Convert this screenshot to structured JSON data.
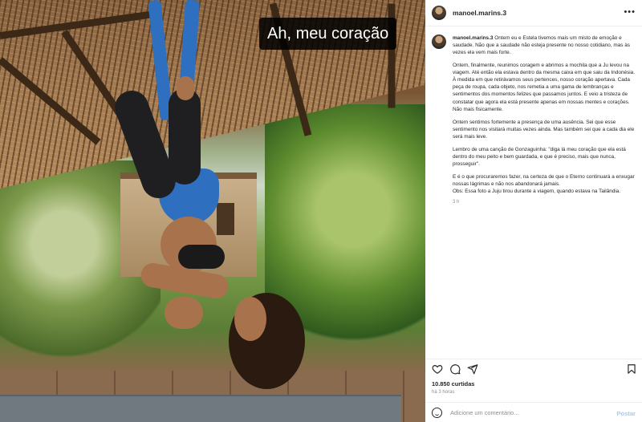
{
  "photo": {
    "sticker_text": "Ah, meu coração"
  },
  "header": {
    "username": "manoel.marins.3",
    "more_icon": "more-horizontal-icon"
  },
  "caption": {
    "username": "manoel.marins.3",
    "paragraphs": [
      "Ontem eu e Estela tivemos mais um misto de emoção e saudade. Não que a saudade não esteja presente no nosso cotidiano, mas às vezes ela vem mais forte.",
      "Ontem, finalmente, reunimos coragem e abrimos a mochila que a Ju levou na viagem. Até então ela estava dentro da mesma caixa em que saiu da Indonésia. À medida em que retirávamos seus pertences, nosso coração apertava. Cada peça de roupa, cada objeto, nos remetia a uma gama de lembranças e sentimentos dos momentos felizes que passamos juntos. E veio a tristeza de constatar que agora ela está presente apenas em nossas mentes e corações. Não mais fisicamente.",
      "Ontem sentimos fortemente a presença de uma ausência. Sei que esse sentimento nos visitará muitas vezes ainda. Mas também sei que a cada dia ele será mais leve.",
      "Lembro de uma canção de Gonzaguinha: \"diga lá meu coração que ela está dentro do meu peito e bem guardada, e que é preciso, mais que nunca, prosseguir\".",
      "E é o que procuraremos fazer, na certeza de que o Eterno continuará a enxugar nossas lágrimas e não nos abandonará jamais.\nObs: Essa foto a Juju tirou durante a viagem, quando estava na Tailândia."
    ],
    "time": "3 h"
  },
  "actions": {
    "icons": [
      "heart-icon",
      "comment-icon",
      "share-icon",
      "bookmark-icon"
    ]
  },
  "likes": "10.850 curtidas",
  "posted_ago": "há 3 horas",
  "comment": {
    "placeholder": "Adicione um comentário...",
    "post_label": "Postar"
  }
}
